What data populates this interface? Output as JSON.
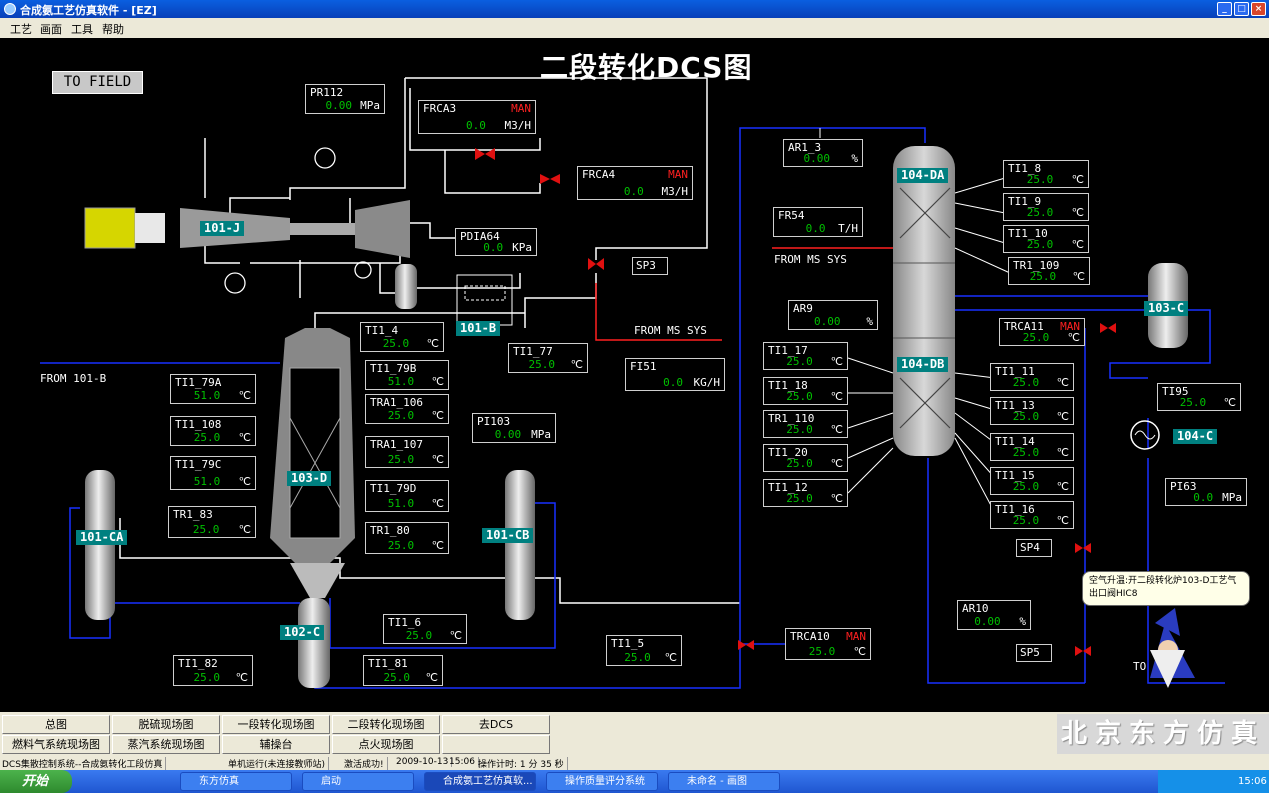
{
  "window": {
    "title": "合成氨工艺仿真软件 - [EZ]",
    "btn_min": "_",
    "btn_max": "□",
    "btn_close": "×"
  },
  "menu": [
    "工艺",
    "画面",
    "工具",
    "帮助"
  ],
  "diagram": {
    "title": "二段转化DCS图",
    "to_field": "TO FIELD",
    "labels": {
      "from_101b": "FROM 101-B",
      "from_ms_sys_1": "FROM MS SYS",
      "from_ms_sys_2": "FROM MS SYS",
      "to_partial": "TO"
    },
    "equipment": [
      "101-J",
      "101-B",
      "103-D",
      "101-CA",
      "101-CB",
      "102-C",
      "104-DA",
      "104-DB",
      "103-C",
      "104-C"
    ],
    "tags": [
      {
        "name": "PR112",
        "value": "0.00",
        "unit": "MPa"
      },
      {
        "name": "FRCA3",
        "mode": "MAN",
        "value": "0.0",
        "unit": "M3/H"
      },
      {
        "name": "FRCA4",
        "mode": "MAN",
        "value": "0.0",
        "unit": "M3/H"
      },
      {
        "name": "PDIA64",
        "value": "0.0",
        "unit": "KPa"
      },
      {
        "name": "TI1_4",
        "value": "25.0",
        "unit": "℃"
      },
      {
        "name": "TI1_77",
        "value": "25.0",
        "unit": "℃"
      },
      {
        "name": "FI51",
        "value": "0.0",
        "unit": "KG/H"
      },
      {
        "name": "TI1_79A",
        "value": "51.0",
        "unit": "℃"
      },
      {
        "name": "TI1_79B",
        "value": "51.0",
        "unit": "℃"
      },
      {
        "name": "TRA1_106",
        "value": "25.0",
        "unit": "℃"
      },
      {
        "name": "PI103",
        "value": "0.00",
        "unit": "MPa"
      },
      {
        "name": "TI1_108",
        "value": "25.0",
        "unit": "℃"
      },
      {
        "name": "TRA1_107",
        "value": "25.0",
        "unit": "℃"
      },
      {
        "name": "TI1_79C",
        "value": "51.0",
        "unit": "℃"
      },
      {
        "name": "TI1_79D",
        "value": "51.0",
        "unit": "℃"
      },
      {
        "name": "TR1_83",
        "value": "25.0",
        "unit": "℃"
      },
      {
        "name": "TR1_80",
        "value": "25.0",
        "unit": "℃"
      },
      {
        "name": "TI1_6",
        "value": "25.0",
        "unit": "℃"
      },
      {
        "name": "TI1_82",
        "value": "25.0",
        "unit": "℃"
      },
      {
        "name": "TI1_81",
        "value": "25.0",
        "unit": "℃"
      },
      {
        "name": "TI1_5",
        "value": "25.0",
        "unit": "℃"
      },
      {
        "name": "AR1_3",
        "value": "0.00",
        "unit": "%"
      },
      {
        "name": "FR54",
        "value": "0.0",
        "unit": "T/H"
      },
      {
        "name": "TI1_8",
        "value": "25.0",
        "unit": "℃"
      },
      {
        "name": "TI1_9",
        "value": "25.0",
        "unit": "℃"
      },
      {
        "name": "TI1_10",
        "value": "25.0",
        "unit": "℃"
      },
      {
        "name": "TR1_109",
        "value": "25.0",
        "unit": "℃"
      },
      {
        "name": "AR9",
        "value": "0.00",
        "unit": "%"
      },
      {
        "name": "TRCA11",
        "mode": "MAN",
        "value": "25.0",
        "unit": "℃"
      },
      {
        "name": "TI1_17",
        "value": "25.0",
        "unit": "℃"
      },
      {
        "name": "TI1_18",
        "value": "25.0",
        "unit": "℃"
      },
      {
        "name": "TR1_110",
        "value": "25.0",
        "unit": "℃"
      },
      {
        "name": "TI1_20",
        "value": "25.0",
        "unit": "℃"
      },
      {
        "name": "TI1_12",
        "value": "25.0",
        "unit": "℃"
      },
      {
        "name": "TI1_11",
        "value": "25.0",
        "unit": "℃"
      },
      {
        "name": "TI1_13",
        "value": "25.0",
        "unit": "℃"
      },
      {
        "name": "TI1_14",
        "value": "25.0",
        "unit": "℃"
      },
      {
        "name": "TI1_15",
        "value": "25.0",
        "unit": "℃"
      },
      {
        "name": "TI1_16",
        "value": "25.0",
        "unit": "℃"
      },
      {
        "name": "TI95",
        "value": "25.0",
        "unit": "℃"
      },
      {
        "name": "PI63",
        "value": "0.0",
        "unit": "MPa"
      },
      {
        "name": "AR10",
        "value": "0.00",
        "unit": "%"
      },
      {
        "name": "TRCA10",
        "mode": "MAN",
        "value": "25.0",
        "unit": "℃"
      }
    ],
    "setpoints": [
      "SP3",
      "SP4",
      "SP5"
    ],
    "tip": "空气升温:开二段转化炉103-D工艺气出口阀HIC8"
  },
  "nav": {
    "row1": [
      "总图",
      "脱硫现场图",
      "一段转化现场图",
      "二段转化现场图",
      "去DCS"
    ],
    "row2": [
      "燃料气系统现场图",
      "蒸汽系统现场图",
      "辅操台",
      "点火现场图",
      ""
    ],
    "brand": "北京东方仿真"
  },
  "status": {
    "system": "DCS集散控制系统--合成氨转化工段仿真",
    "mode": "单机运行(未连接教师站)",
    "activation": "激活成功!",
    "date": "2009-10-13",
    "time": "15:06",
    "timer": "操作计时: 1 分 35 秒"
  },
  "taskbar": {
    "start": "开始",
    "tasks": [
      "东方仿真",
      "启动",
      "合成氨工艺仿真软...",
      "操作质量评分系统",
      "未命名 - 画图"
    ],
    "clock": "15:06"
  }
}
